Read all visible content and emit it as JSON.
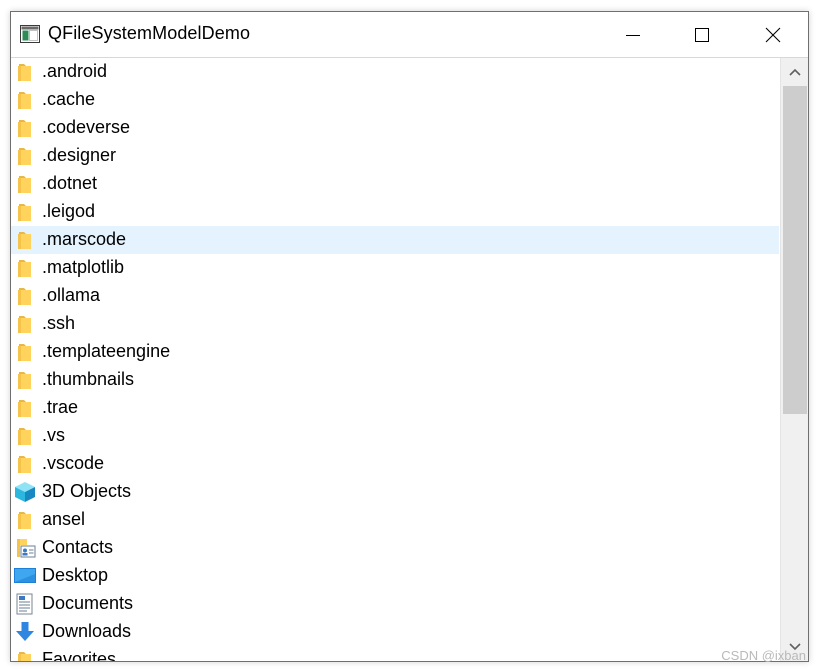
{
  "window": {
    "title": "QFileSystemModelDemo",
    "icon": "qt-window-icon"
  },
  "controls": {
    "minimize_icon": "minimize-icon",
    "maximize_icon": "maximize-icon",
    "close_icon": "close-icon"
  },
  "tree": {
    "items": [
      {
        "label": ".android",
        "icon": "folder-icon",
        "selected": false
      },
      {
        "label": ".cache",
        "icon": "folder-icon",
        "selected": false
      },
      {
        "label": ".codeverse",
        "icon": "folder-icon",
        "selected": false
      },
      {
        "label": ".designer",
        "icon": "folder-icon",
        "selected": false
      },
      {
        "label": ".dotnet",
        "icon": "folder-icon",
        "selected": false
      },
      {
        "label": ".leigod",
        "icon": "folder-icon",
        "selected": false
      },
      {
        "label": ".marscode",
        "icon": "folder-icon",
        "selected": true
      },
      {
        "label": ".matplotlib",
        "icon": "folder-icon",
        "selected": false
      },
      {
        "label": ".ollama",
        "icon": "folder-icon",
        "selected": false
      },
      {
        "label": ".ssh",
        "icon": "folder-icon",
        "selected": false
      },
      {
        "label": ".templateengine",
        "icon": "folder-icon",
        "selected": false
      },
      {
        "label": ".thumbnails",
        "icon": "folder-icon",
        "selected": false
      },
      {
        "label": ".trae",
        "icon": "folder-icon",
        "selected": false
      },
      {
        "label": ".vs",
        "icon": "folder-icon",
        "selected": false
      },
      {
        "label": ".vscode",
        "icon": "folder-icon",
        "selected": false
      },
      {
        "label": "3D Objects",
        "icon": "3d-objects-icon",
        "selected": false
      },
      {
        "label": "ansel",
        "icon": "folder-icon",
        "selected": false
      },
      {
        "label": "Contacts",
        "icon": "contacts-icon",
        "selected": false
      },
      {
        "label": "Desktop",
        "icon": "desktop-icon",
        "selected": false
      },
      {
        "label": "Documents",
        "icon": "documents-icon",
        "selected": false
      },
      {
        "label": "Downloads",
        "icon": "downloads-icon",
        "selected": false
      },
      {
        "label": "Favorites",
        "icon": "folder-icon",
        "selected": false
      }
    ],
    "selected_bg": "#e5f3ff",
    "folder_color": "#ffd35c"
  },
  "scrollbar": {
    "position": 0.0,
    "visible_fraction": 0.6,
    "up_icon": "chevron-up-icon",
    "down_icon": "chevron-down-icon"
  },
  "watermark": "CSDN @ixban"
}
